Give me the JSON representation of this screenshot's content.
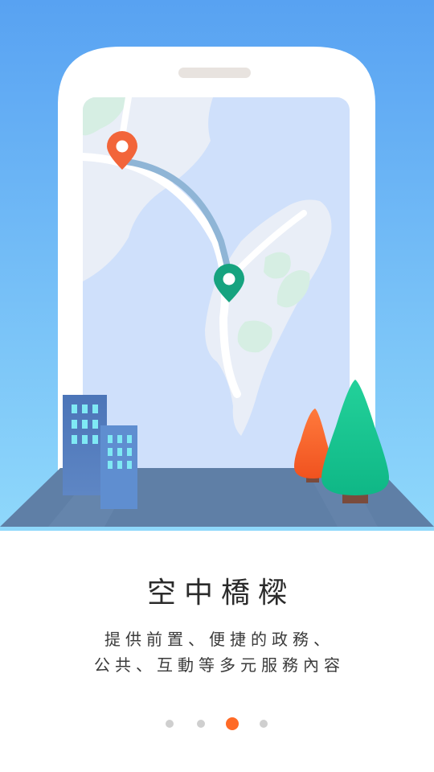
{
  "onboarding": {
    "title": "空中橋樑",
    "description_line1": "提供前置、便捷的政務、",
    "description_line2": "公共、互動等多元服務內容",
    "page_count": 4,
    "current_page": 3
  },
  "illustration": {
    "icons": [
      "origin-pin-icon",
      "destination-pin-icon",
      "building-icon",
      "tree-icon"
    ]
  },
  "colors": {
    "sky_top": "#5aa5f3",
    "sky_bottom": "#8fd6fb",
    "map_water": "#cfe0fb",
    "map_land": "#e9eef7",
    "route": "#8fb5d6",
    "origin_pin": "#f2653a",
    "destination_pin": "#16a37f",
    "ground": "#5f7fa6",
    "accent": "#ff6a26",
    "dot_inactive": "#cfcfcf"
  }
}
